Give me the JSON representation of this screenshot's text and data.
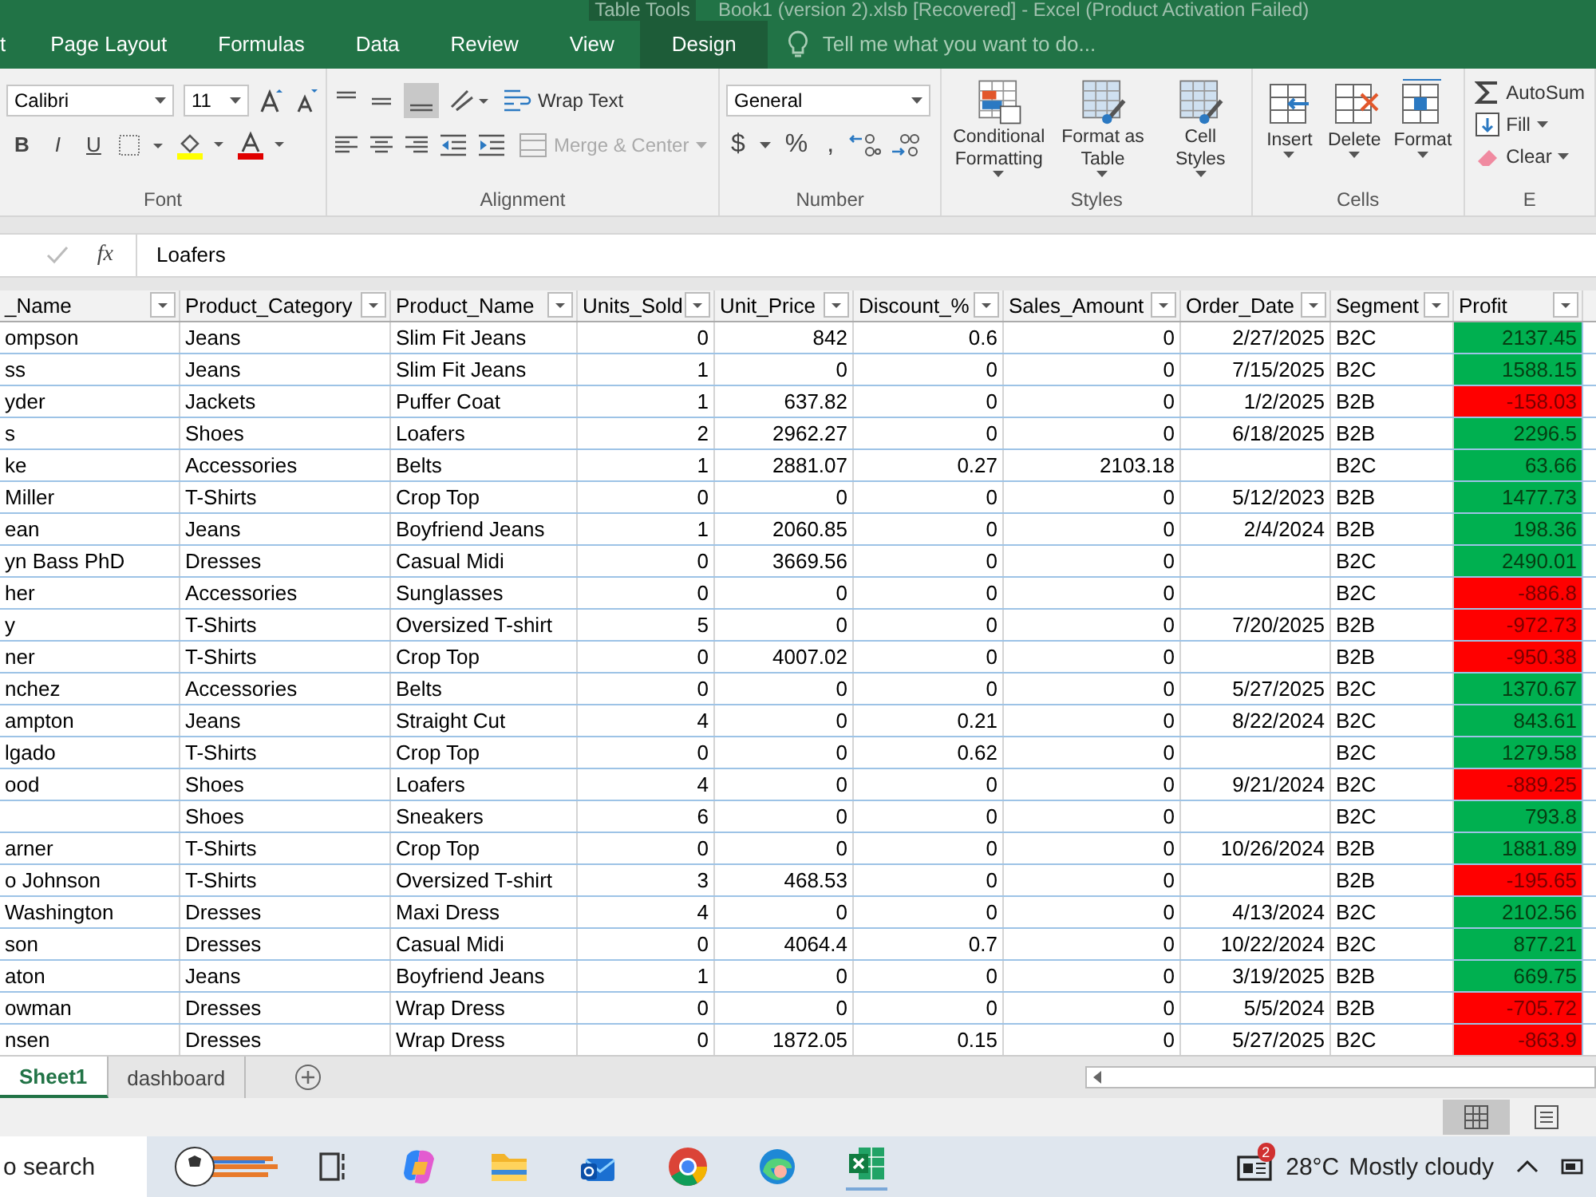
{
  "title_bar": {
    "context_label": "Table Tools",
    "title": "Book1 (version 2).xlsb [Recovered] - Excel (Product Activation Failed)"
  },
  "ribbon_tabs": [
    {
      "label": "t",
      "contextual": false
    },
    {
      "label": "Page Layout",
      "contextual": false
    },
    {
      "label": "Formulas",
      "contextual": false
    },
    {
      "label": "Data",
      "contextual": false
    },
    {
      "label": "Review",
      "contextual": false
    },
    {
      "label": "View",
      "contextual": false
    },
    {
      "label": "Design",
      "contextual": true
    }
  ],
  "tell_me": {
    "placeholder": "Tell me what you want to do..."
  },
  "font_group": {
    "font": "Calibri",
    "size": "11",
    "bold": "B",
    "italic": "I",
    "underline": "U",
    "label": "Font"
  },
  "alignment_group": {
    "wrap_text": "Wrap Text",
    "merge_center": "Merge & Center",
    "merge_disabled": true,
    "label": "Alignment"
  },
  "number_group": {
    "format": "General",
    "currency": "$",
    "percent": "%",
    "comma": ",",
    "label": "Number"
  },
  "styles_group": {
    "buttons": [
      "Conditional Formatting",
      "Format as Table",
      "Cell Styles"
    ],
    "label": "Styles"
  },
  "cells_group": {
    "buttons": [
      "Insert",
      "Delete",
      "Format"
    ],
    "label": "Cells"
  },
  "editing_group": {
    "autosum": "AutoSum",
    "fill": "Fill",
    "clear": "Clear",
    "label": "E"
  },
  "formula_bar": {
    "fx": "fx",
    "value": "Loafers"
  },
  "table": {
    "columns": [
      "_Name",
      "Product_Category",
      "Product_Name",
      "Units_Sold",
      "Unit_Price",
      "Discount_%",
      "Sales_Amount",
      "Order_Date",
      "Segment",
      "Profit"
    ],
    "rows": [
      {
        "name": "ompson",
        "category": "Jeans",
        "product": "Slim Fit Jeans",
        "units": "0",
        "price": "842",
        "discount": "0.6",
        "sales": "0",
        "order_date": "2/27/2025",
        "segment": "B2C",
        "profit": "2137.45",
        "color": "#00b050"
      },
      {
        "name": "ss",
        "category": "Jeans",
        "product": "Slim Fit Jeans",
        "units": "1",
        "price": "0",
        "discount": "0",
        "sales": "0",
        "order_date": "7/15/2025",
        "segment": "B2C",
        "profit": "1588.15",
        "color": "#00b050"
      },
      {
        "name": "yder",
        "category": "Jackets",
        "product": "Puffer Coat",
        "units": "1",
        "price": "637.82",
        "discount": "0",
        "sales": "0",
        "order_date": "1/2/2025",
        "segment": "B2B",
        "profit": "-158.03",
        "color": "#ff0000"
      },
      {
        "name": "s",
        "category": "Shoes",
        "product": "Loafers",
        "units": "2",
        "price": "2962.27",
        "discount": "0",
        "sales": "0",
        "order_date": "6/18/2025",
        "segment": "B2B",
        "profit": "2296.5",
        "color": "#00b050"
      },
      {
        "name": "ke",
        "category": "Accessories",
        "product": "Belts",
        "units": "1",
        "price": "2881.07",
        "discount": "0.27",
        "sales": "2103.18",
        "segment": "B2C",
        "profit": "63.66",
        "color": "#00b050"
      },
      {
        "name": "Miller",
        "category": "T-Shirts",
        "product": "Crop Top",
        "units": "0",
        "price": "0",
        "discount": "0",
        "sales": "0",
        "order_date": "5/12/2023",
        "segment": "B2B",
        "profit": "1477.73",
        "color": "#00b050"
      },
      {
        "name": "ean",
        "category": "Jeans",
        "product": "Boyfriend Jeans",
        "units": "1",
        "price": "2060.85",
        "discount": "0",
        "sales": "0",
        "order_date": "2/4/2024",
        "segment": "B2B",
        "profit": "198.36",
        "color": "#00b050"
      },
      {
        "name": "yn Bass PhD",
        "category": "Dresses",
        "product": "Casual Midi",
        "units": "0",
        "price": "3669.56",
        "discount": "0",
        "sales": "0",
        "segment": "B2C",
        "profit": "2490.01",
        "color": "#00b050"
      },
      {
        "name": "her",
        "category": "Accessories",
        "product": "Sunglasses",
        "units": "0",
        "price": "0",
        "discount": "0",
        "sales": "0",
        "segment": "B2C",
        "profit": "-886.8",
        "color": "#ff0000"
      },
      {
        "name": "y",
        "category": "T-Shirts",
        "product": "Oversized T-shirt",
        "units": "5",
        "price": "0",
        "discount": "0",
        "sales": "0",
        "order_date": "7/20/2025",
        "segment": "B2B",
        "profit": "-972.73",
        "color": "#ff0000"
      },
      {
        "name": "ner",
        "category": "T-Shirts",
        "product": "Crop Top",
        "units": "0",
        "price": "4007.02",
        "discount": "0",
        "sales": "0",
        "segment": "B2B",
        "profit": "-950.38",
        "color": "#ff0000"
      },
      {
        "name": "nchez",
        "category": "Accessories",
        "product": "Belts",
        "units": "0",
        "price": "0",
        "discount": "0",
        "sales": "0",
        "order_date": "5/27/2025",
        "segment": "B2C",
        "profit": "1370.67",
        "color": "#00b050"
      },
      {
        "name": "ampton",
        "category": "Jeans",
        "product": "Straight Cut",
        "units": "4",
        "price": "0",
        "discount": "0.21",
        "sales": "0",
        "order_date": "8/22/2024",
        "segment": "B2C",
        "profit": "843.61",
        "color": "#00b050"
      },
      {
        "name": "lgado",
        "category": "T-Shirts",
        "product": "Crop Top",
        "units": "0",
        "price": "0",
        "discount": "0.62",
        "sales": "0",
        "segment": "B2C",
        "profit": "1279.58",
        "color": "#00b050"
      },
      {
        "name": "ood",
        "category": "Shoes",
        "product": "Loafers",
        "units": "4",
        "price": "0",
        "discount": "0",
        "sales": "0",
        "order_date": "9/21/2024",
        "segment": "B2C",
        "profit": "-889.25",
        "color": "#ff0000"
      },
      {
        "category": "Shoes",
        "product": "Sneakers",
        "units": "6",
        "price": "0",
        "discount": "0",
        "sales": "0",
        "segment": "B2C",
        "profit": "793.8",
        "color": "#00b050"
      },
      {
        "name": "arner",
        "category": "T-Shirts",
        "product": "Crop Top",
        "units": "0",
        "price": "0",
        "discount": "0",
        "sales": "0",
        "order_date": "10/26/2024",
        "segment": "B2B",
        "profit": "1881.89",
        "color": "#00b050"
      },
      {
        "name": "o Johnson",
        "category": "T-Shirts",
        "product": "Oversized T-shirt",
        "units": "3",
        "price": "468.53",
        "discount": "0",
        "sales": "0",
        "segment": "B2B",
        "profit": "-195.65",
        "color": "#ff0000"
      },
      {
        "name": "Washington",
        "category": "Dresses",
        "product": "Maxi Dress",
        "units": "4",
        "price": "0",
        "discount": "0",
        "sales": "0",
        "order_date": "4/13/2024",
        "segment": "B2C",
        "profit": "2102.56",
        "color": "#00b050"
      },
      {
        "name": "son",
        "category": "Dresses",
        "product": "Casual Midi",
        "units": "0",
        "price": "4064.4",
        "discount": "0.7",
        "sales": "0",
        "order_date": "10/22/2024",
        "segment": "B2C",
        "profit": "877.21",
        "color": "#00b050"
      },
      {
        "name": "aton",
        "category": "Jeans",
        "product": "Boyfriend Jeans",
        "units": "1",
        "price": "0",
        "discount": "0",
        "sales": "0",
        "order_date": "3/19/2025",
        "segment": "B2B",
        "profit": "669.75",
        "color": "#00b050"
      },
      {
        "name": "owman",
        "category": "Dresses",
        "product": "Wrap Dress",
        "units": "0",
        "price": "0",
        "discount": "0",
        "sales": "0",
        "order_date": "5/5/2024",
        "segment": "B2B",
        "profit": "-705.72",
        "color": "#ff0000"
      },
      {
        "name": "nsen",
        "category": "Dresses",
        "product": "Wrap Dress",
        "units": "0",
        "price": "1872.05",
        "discount": "0.15",
        "sales": "0",
        "order_date": "5/27/2025",
        "segment": "B2C",
        "profit": "-863.9",
        "color": "#ff0000"
      }
    ]
  },
  "sheet_tabs": [
    {
      "label": "Sheet1",
      "selected": true
    },
    {
      "label": "dashboard",
      "selected": false
    }
  ],
  "taskbar": {
    "search": "o search",
    "weather_badge": "2",
    "temperature": "28°C",
    "weather": "Mostly cloudy"
  }
}
